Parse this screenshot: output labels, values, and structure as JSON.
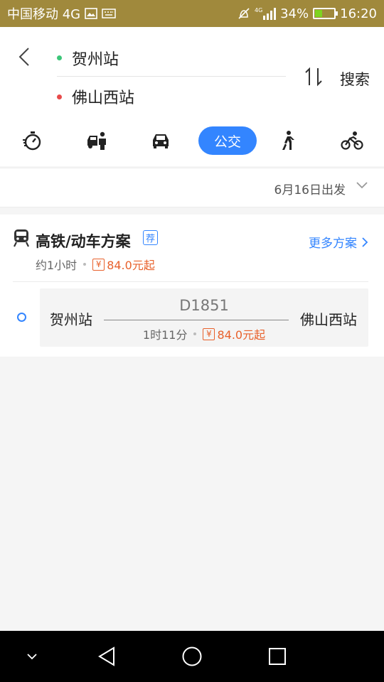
{
  "status_bar": {
    "carrier": "中国移动 4G",
    "battery_percent": "34%",
    "battery_level": 0.34,
    "time": "16:20",
    "signal_label": "4G"
  },
  "header": {
    "origin": "贺州站",
    "destination": "佛山西站",
    "search_label": "搜索",
    "modes": [
      {
        "id": "timer",
        "icon": "stopwatch-icon"
      },
      {
        "id": "taxi",
        "icon": "taxi-person-icon"
      },
      {
        "id": "car",
        "icon": "car-icon"
      },
      {
        "id": "bus",
        "label": "公交",
        "active": true
      },
      {
        "id": "walk",
        "icon": "walk-icon"
      },
      {
        "id": "bike",
        "icon": "bike-icon"
      }
    ]
  },
  "date_bar": {
    "text": "6月16日出发"
  },
  "plan": {
    "title": "高铁/动车方案",
    "badge": "荐",
    "more_label": "更多方案",
    "duration": "约1小时",
    "price": "84.0元起",
    "yen_symbol": "¥",
    "train": {
      "from": "贺州站",
      "to": "佛山西站",
      "number": "D1851",
      "duration": "1时11分",
      "price": "84.0元起"
    }
  },
  "colors": {
    "status_bar": "#a0893c",
    "accent": "#3385ff",
    "price": "#e8612c",
    "origin_dot": "#3cc679",
    "destination_dot": "#e84a4a"
  }
}
